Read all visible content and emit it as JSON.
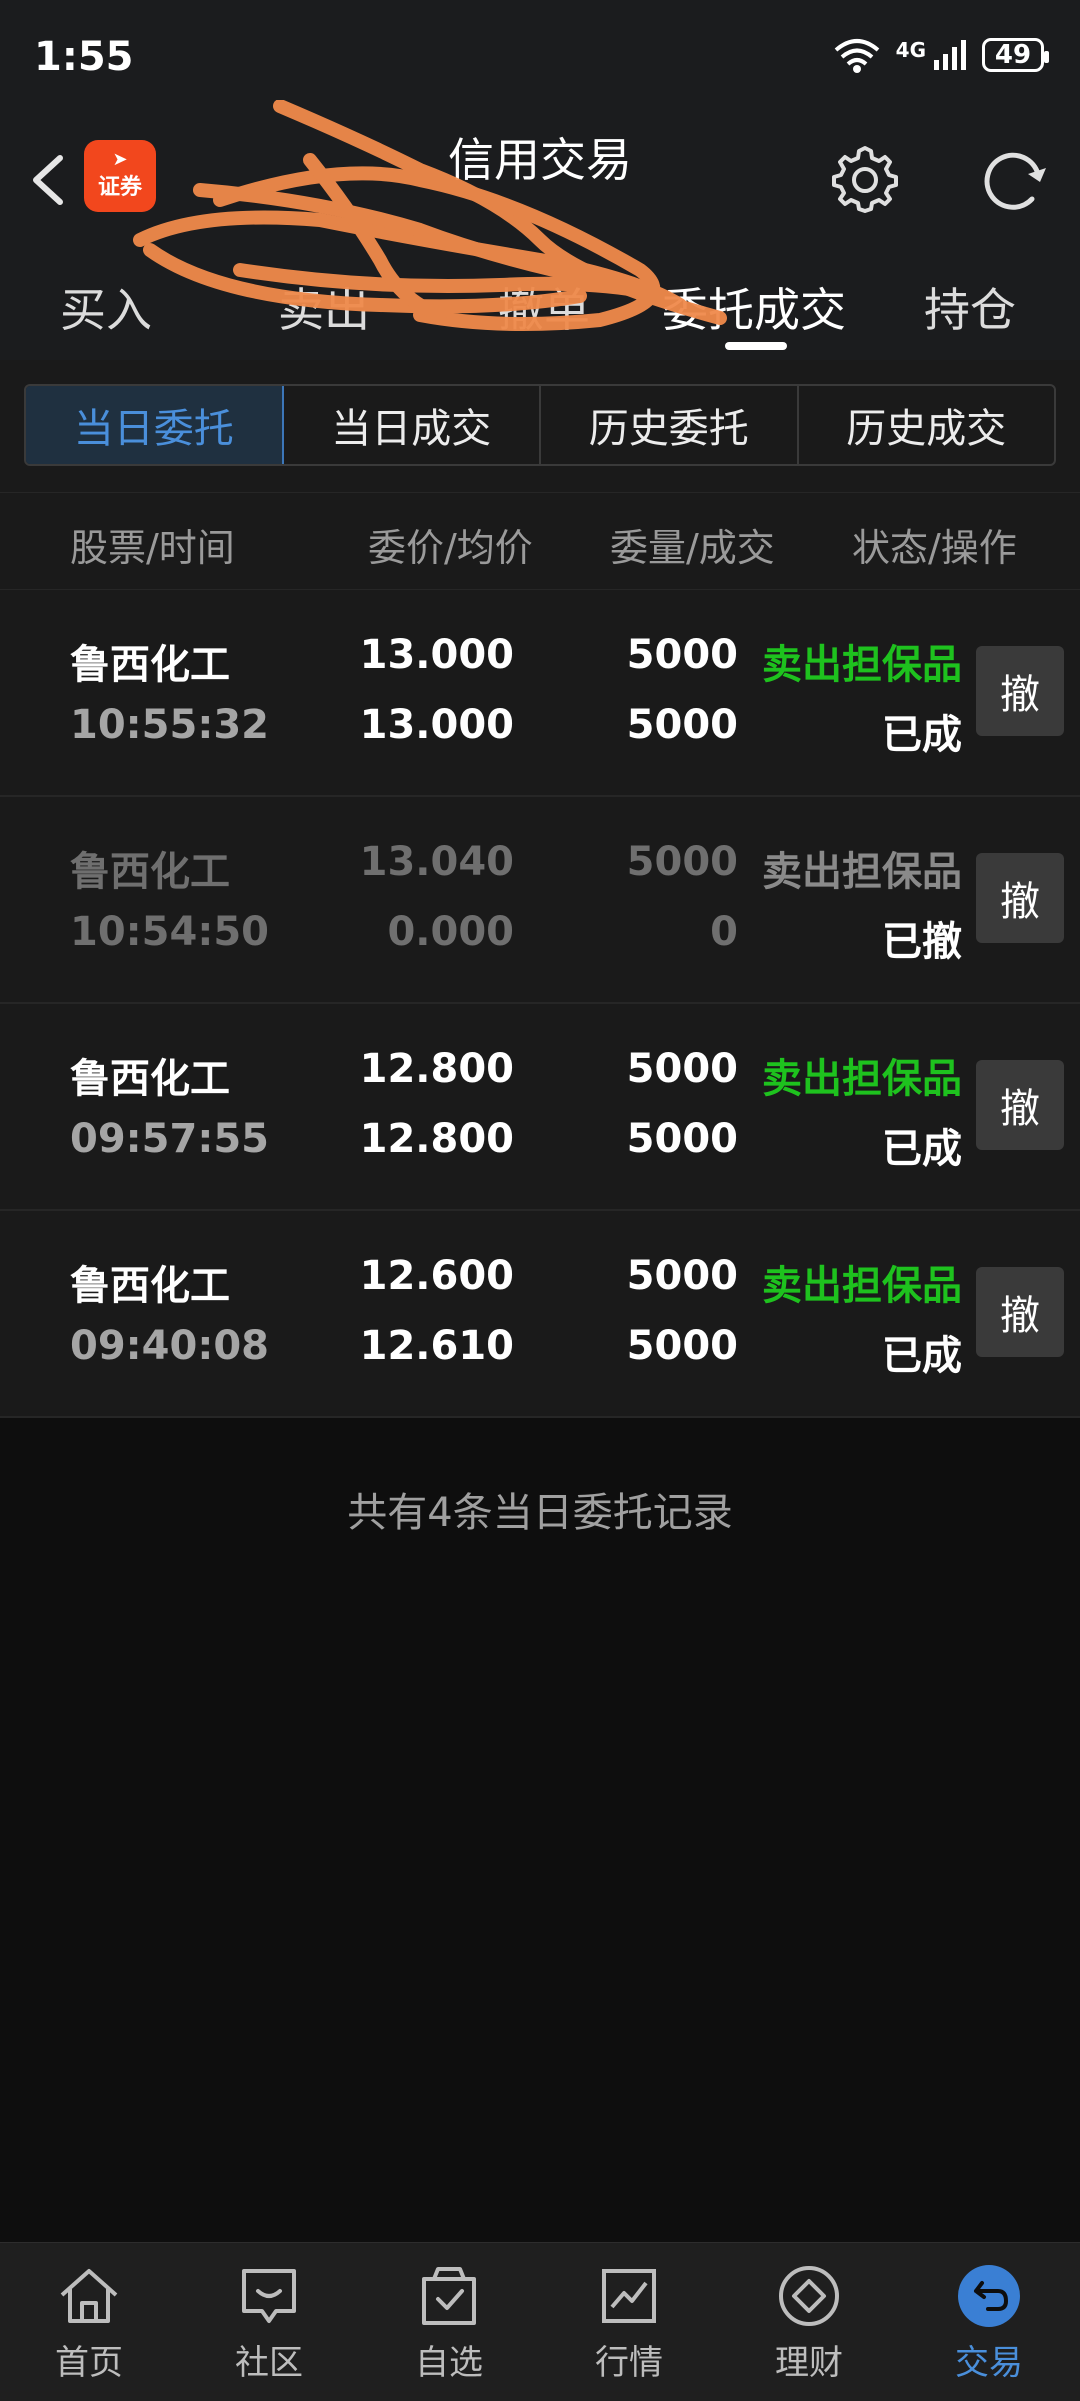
{
  "status_bar": {
    "time": "1:55",
    "network": "4G",
    "battery": "49"
  },
  "header": {
    "title": "信用交易",
    "brand_text": "证券"
  },
  "trade_tabs": [
    "买入",
    "卖出",
    "撤单",
    "委托成交",
    "持仓"
  ],
  "segments": [
    "当日委托",
    "当日成交",
    "历史委托",
    "历史成交"
  ],
  "columns": [
    "股票/时间",
    "委价/均价",
    "委量/成交",
    "状态/操作"
  ],
  "orders": [
    {
      "name": "鲁西化工",
      "time": "10:55:32",
      "price": "13.000",
      "avg": "13.000",
      "qty": "5000",
      "filled": "5000",
      "type": "卖出担保品",
      "status": "已成",
      "action": "撤"
    },
    {
      "name": "鲁西化工",
      "time": "10:54:50",
      "price": "13.040",
      "avg": "0.000",
      "qty": "5000",
      "filled": "0",
      "type": "卖出担保品",
      "status": "已撤",
      "action": "撤"
    },
    {
      "name": "鲁西化工",
      "time": "09:57:55",
      "price": "12.800",
      "avg": "12.800",
      "qty": "5000",
      "filled": "5000",
      "type": "卖出担保品",
      "status": "已成",
      "action": "撤"
    },
    {
      "name": "鲁西化工",
      "time": "09:40:08",
      "price": "12.600",
      "avg": "12.610",
      "qty": "5000",
      "filled": "5000",
      "type": "卖出担保品",
      "status": "已成",
      "action": "撤"
    }
  ],
  "footer_note": "共有4条当日委托记录",
  "bottom_nav": [
    "首页",
    "社区",
    "自选",
    "行情",
    "理财",
    "交易"
  ],
  "colors": {
    "accent": "#4a8fdb",
    "buy_green": "#1ec21e",
    "brand": "#f2471d",
    "scribble": "#f08a4b"
  }
}
